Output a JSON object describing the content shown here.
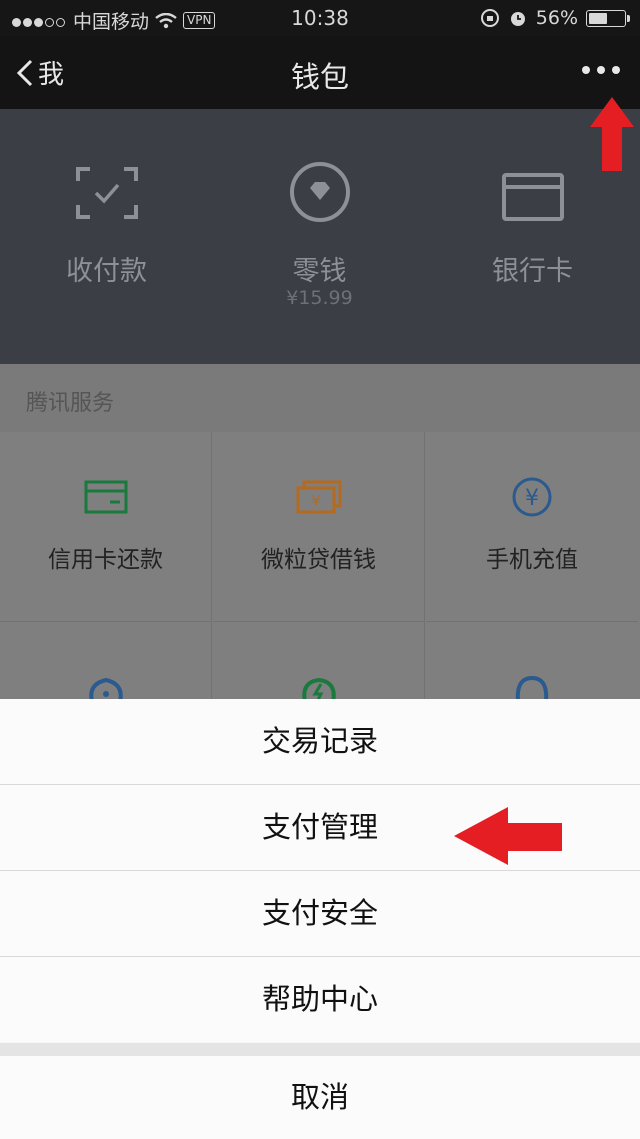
{
  "status": {
    "carrier": "中国移动",
    "vpn": "VPN",
    "time": "10:38",
    "battery": "56%",
    "battery_level": 0.56
  },
  "nav": {
    "back_label": "我",
    "title": "钱包"
  },
  "wallet": [
    {
      "label": "收付款",
      "icon": "scan-icon"
    },
    {
      "label": "零钱",
      "sub": "¥15.99",
      "icon": "diamond-coin-icon"
    },
    {
      "label": "银行卡",
      "icon": "card-icon"
    }
  ],
  "services": {
    "header": "腾讯服务",
    "items": [
      {
        "label": "信用卡还款",
        "icon": "credit-card-icon",
        "color": "#1a7a3e"
      },
      {
        "label": "微粒贷借钱",
        "icon": "loan-icon",
        "color": "#b46a1f"
      },
      {
        "label": "手机充值",
        "icon": "yuan-icon",
        "color": "#2a5a8e"
      }
    ]
  },
  "sheet": {
    "items": [
      "交易记录",
      "支付管理",
      "支付安全",
      "帮助中心"
    ],
    "cancel": "取消"
  },
  "colors": {
    "annotation_arrow": "#e51e23"
  }
}
